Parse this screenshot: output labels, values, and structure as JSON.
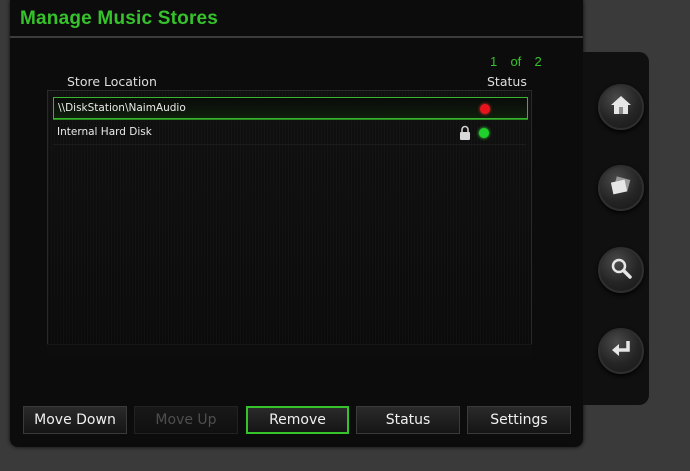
{
  "header": {
    "title": "Manage Music Stores"
  },
  "pagination": {
    "text": "1  of  2"
  },
  "table": {
    "columns": {
      "location": "Store Location",
      "status": "Status"
    },
    "rows": [
      {
        "location": "\\\\DiskStation\\NaimAudio",
        "status_color": "#e8141c",
        "locked": false,
        "selected": true
      },
      {
        "location": "Internal Hard Disk",
        "status_color": "#1fd12a",
        "locked": true,
        "selected": false
      }
    ]
  },
  "buttons": {
    "move_down": "Move Down",
    "move_up": "Move Up",
    "remove": "Remove",
    "status": "Status",
    "settings": "Settings"
  },
  "side_nav": [
    "home-icon",
    "albums-icon",
    "search-icon",
    "back-icon"
  ],
  "colors": {
    "accent": "#35c22b",
    "status_offline": "#e8141c",
    "status_online": "#1fd12a"
  }
}
